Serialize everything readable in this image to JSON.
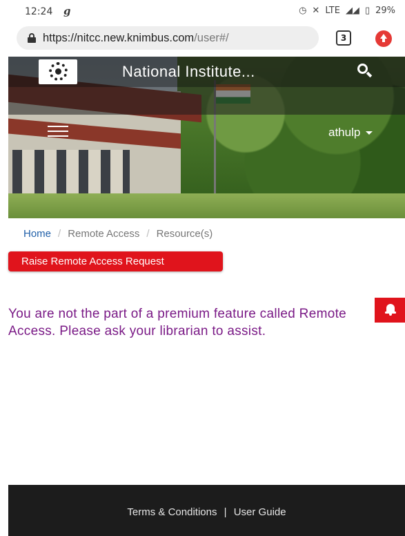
{
  "status_bar": {
    "time": "12:24",
    "carrier_icon": "g",
    "network": "LTE",
    "battery": "29%",
    "icons": [
      "alarm-icon",
      "mute-icon",
      "signal-icon",
      "battery-icon"
    ]
  },
  "browser": {
    "url_host": "https://nitcc.new.knimbus.com",
    "url_path": "/user#/",
    "tabs_count": "3"
  },
  "header": {
    "site_title": "National Institute...",
    "username": "athulp"
  },
  "breadcrumb": {
    "home": "Home",
    "separator": "/",
    "remote_access": "Remote Access",
    "resources": "Resource(s)"
  },
  "main": {
    "raise_button_label": "Raise Remote Access Request",
    "message": "You are not the part of a premium feature called Remote Access. Please ask your librarian to assist."
  },
  "footer": {
    "terms": "Terms & Conditions",
    "divider": "|",
    "guide": "User Guide"
  },
  "colors": {
    "accent_red": "#e0141c",
    "message_purple": "#7a1a86",
    "link_blue": "#1f5fa8",
    "footer_bg": "#1c1c1c"
  }
}
